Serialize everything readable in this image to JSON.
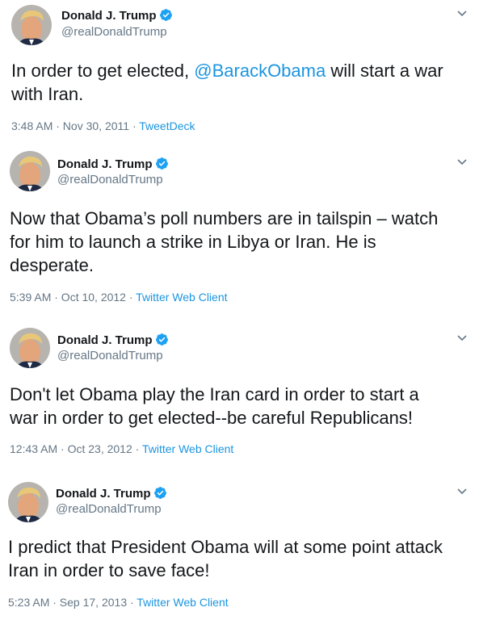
{
  "author": {
    "name": "Donald J. Trump",
    "handle": "@realDonaldTrump",
    "avatar": "avatar-photo"
  },
  "colors": {
    "link": "#1b95e0",
    "muted": "#657786",
    "text": "#14171a"
  },
  "tweets": [
    {
      "text_prefix": "In order to get elected, ",
      "mention": "@BarackObama",
      "text_suffix": " will start a war\nwith Iran.",
      "time": "3:48 AM · Nov 30, 2011 · ",
      "source": "TweetDeck"
    },
    {
      "text": "Now that Obama’s poll numbers are in tailspin – watch\nfor him to launch a strike in Libya or Iran.  He is\ndesperate.",
      "time": "5:39 AM · Oct 10, 2012 · ",
      "source": "Twitter Web Client"
    },
    {
      "text": "Don't let Obama play the Iran card in order to start a\nwar in order to get elected--be careful Republicans!",
      "time": "12:43 AM · Oct 23, 2012 · ",
      "source": "Twitter Web Client"
    },
    {
      "text": "I predict that President Obama will at some point attack\nIran in order to save face!",
      "time": "5:23 AM · Sep 17, 2013 · ",
      "source": "Twitter Web Client"
    }
  ]
}
